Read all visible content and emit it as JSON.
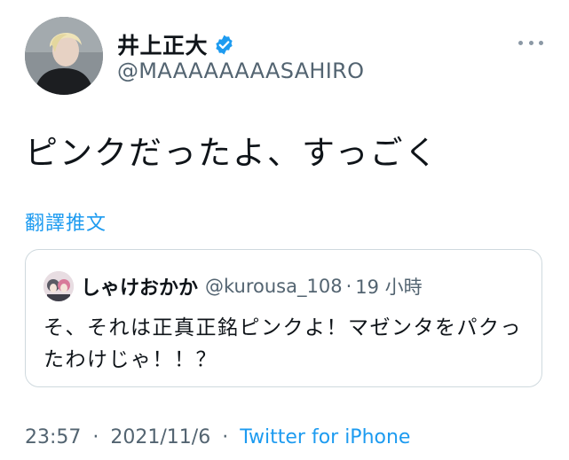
{
  "author": {
    "display_name": "井上正大",
    "handle": "@MAAAAAAAASAHIRO",
    "avatar_icon": "user-avatar-icon",
    "verified_icon": "verified-badge-icon"
  },
  "tweet": {
    "text": "ピンクだったよ、すっごく",
    "translate_label": "翻譯推文"
  },
  "quoted_tweet": {
    "display_name": "しゃけおかか",
    "handle": "@kurousa_108",
    "separator": "·",
    "time": "19 小時",
    "text": "そ、それは正真正銘ピンクよ！マゼンタをパクったわけじゃ！！？"
  },
  "meta": {
    "time": "23:57",
    "separator1": "·",
    "date": "2021/11/6",
    "separator2": "·",
    "source": "Twitter for iPhone"
  },
  "colors": {
    "link_blue": "#1d9bf0",
    "secondary_text": "#536471",
    "border": "#cfd9de",
    "primary_text": "#0f1419"
  },
  "more_icon": "more-options-icon"
}
